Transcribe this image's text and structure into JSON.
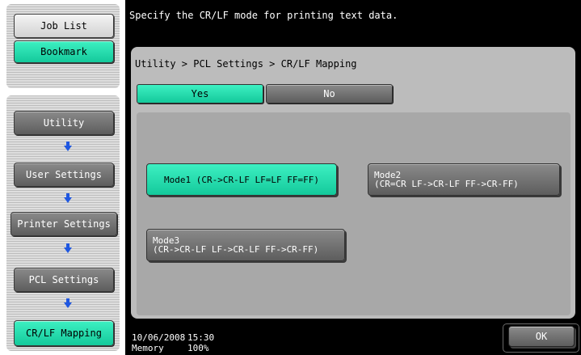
{
  "sidebar": {
    "job_list": "Job List",
    "bookmark": "Bookmark",
    "items": [
      {
        "label": "Utility"
      },
      {
        "label": "User Settings"
      },
      {
        "label": "Printer Settings"
      },
      {
        "label": "PCL Settings"
      },
      {
        "label": "CR/LF Mapping"
      }
    ]
  },
  "message": "Specify the CR/LF mode for printing text data.",
  "breadcrumb": "Utility > PCL Settings > CR/LF Mapping",
  "toggle": {
    "yes": "Yes",
    "no": "No",
    "selected": "Yes"
  },
  "modes": [
    {
      "line1": "Mode1 (CR->CR-LF LF=LF FF=FF)",
      "line2": "",
      "selected": true
    },
    {
      "line1": "Mode2",
      "line2": "(CR=CR LF->CR-LF FF->CR-FF)",
      "selected": false
    },
    {
      "line1": "Mode3",
      "line2": "(CR->CR-LF LF->CR-LF FF->CR-FF)",
      "selected": false
    }
  ],
  "footer": {
    "date": "10/06/2008",
    "time": "15:30",
    "memory_label": "Memory",
    "memory_value": "100%",
    "ok": "OK"
  },
  "colors": {
    "selected_green": "#14c99b",
    "unselected_gray": "#5d5d5d",
    "arrow_blue": "#1f57e0"
  }
}
